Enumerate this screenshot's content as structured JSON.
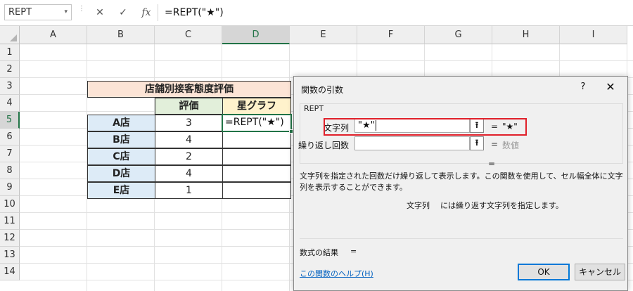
{
  "formula_bar": {
    "name_box": "REPT",
    "name_box_arrow": "▾",
    "cancel_icon": "✕",
    "enter_icon": "✓",
    "fx_label": "fx",
    "formula": "=REPT(\"★\")"
  },
  "grid": {
    "columns": [
      "A",
      "B",
      "C",
      "D",
      "E",
      "F",
      "G",
      "H",
      "I"
    ],
    "rows": [
      "1",
      "2",
      "3",
      "4",
      "5",
      "6",
      "7",
      "8",
      "9",
      "10",
      "11",
      "12",
      "13",
      "14"
    ],
    "selected_column": "D",
    "selected_row": "5"
  },
  "table": {
    "title": "店舗別接客態度評価",
    "header_rating": "評価",
    "header_graph": "星グラフ",
    "stores": [
      {
        "name": "A店",
        "rating": "3"
      },
      {
        "name": "B店",
        "rating": "4"
      },
      {
        "name": "C店",
        "rating": "2"
      },
      {
        "name": "D店",
        "rating": "4"
      },
      {
        "name": "E店",
        "rating": "1"
      }
    ],
    "active_cell_text": "=REPT(\"★\")"
  },
  "dialog": {
    "title": "関数の引数",
    "help_icon": "?",
    "close_icon": "✕",
    "function_name": "REPT",
    "arg1_label": "文字列",
    "arg1_value": "\"★\"",
    "arg1_eq": "=",
    "arg1_result": "\"★\"",
    "arg2_label": "繰り返し回数",
    "arg2_value": "",
    "arg2_eq": "=",
    "arg2_result": "数値",
    "ref_icon": "⭱",
    "overall_eq": "=",
    "description": "文字列を指定された回数だけ繰り返して表示します。この関数を使用して、セル幅全体に文字列を表示することができます。",
    "arg_desc_label": "文字列",
    "arg_desc_text": "には繰り返す文字列を指定します。",
    "result_label": "数式の結果",
    "result_eq": "=",
    "help_link": "この関数のヘルプ(H)",
    "ok_label": "OK",
    "cancel_label": "キャンセル"
  },
  "colors": {
    "accent_green": "#217346",
    "title_fill": "#fce4d6",
    "store_fill": "#ddebf7",
    "rating_fill": "#e2efda",
    "graph_fill": "#fff2cc",
    "highlight_red": "#e0202a",
    "link_blue": "#0563c1"
  }
}
